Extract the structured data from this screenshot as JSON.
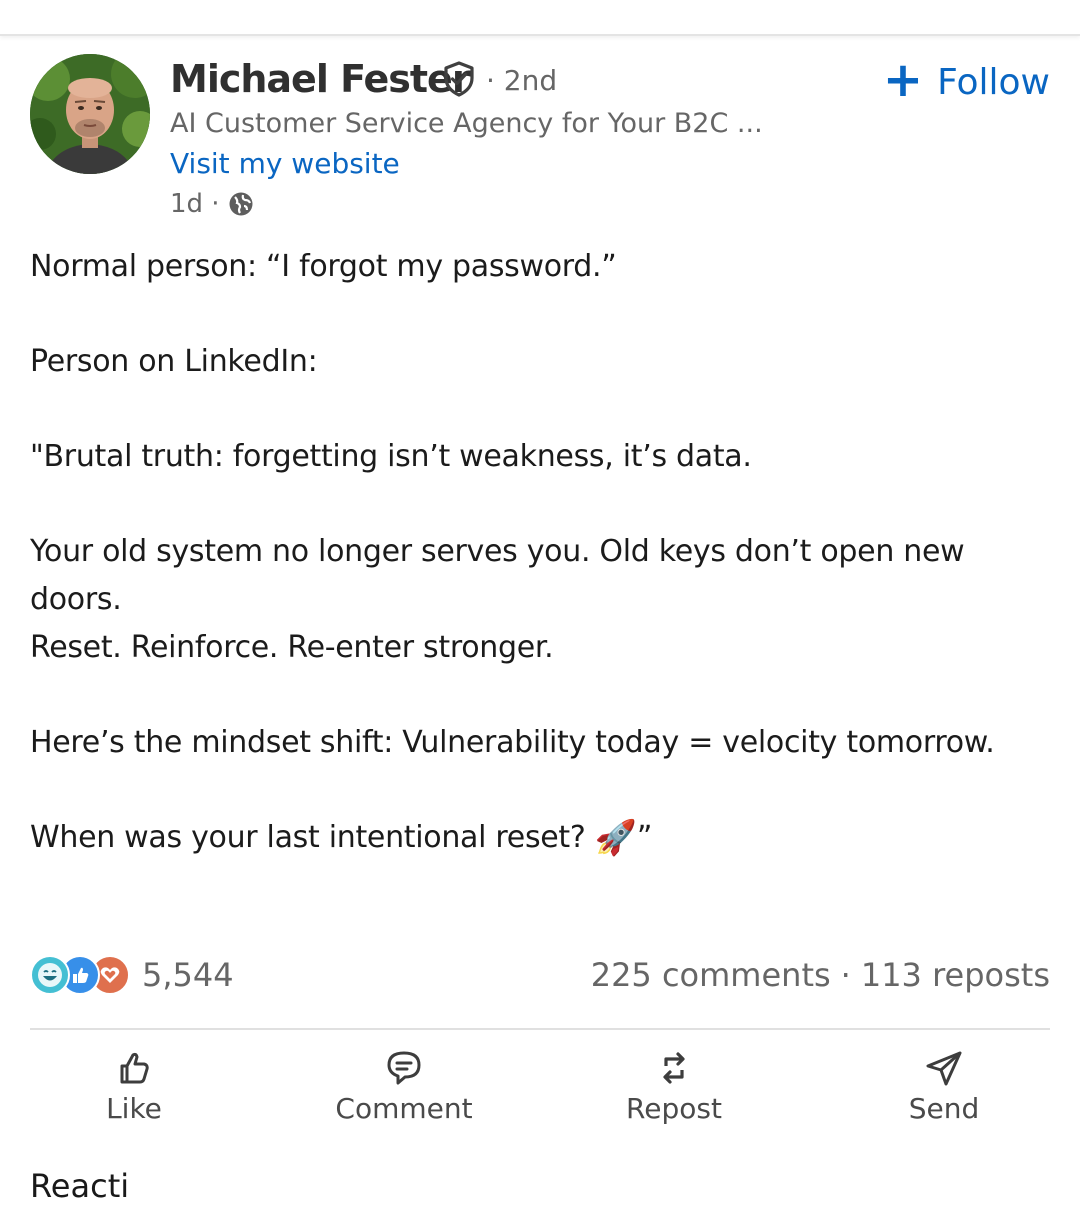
{
  "author": {
    "name": "Michael Fester",
    "degree": "· 2nd",
    "headline": "AI Customer Service Agency for Your B2C ...",
    "website_link": "Visit my website",
    "timestamp": "1d ·"
  },
  "follow": {
    "icon": "+",
    "label": "Follow"
  },
  "post": {
    "lines": [
      "Normal person: “I forgot my password.”",
      "Person on LinkedIn:",
      "\"Brutal truth: forgetting isn’t weakness, it’s data.",
      "Your old system no longer serves you. Old keys don’t open new doors.",
      "Reset. Reinforce. Re-enter stronger.",
      "Here’s the mindset shift: Vulnerability today = velocity tomorrow.",
      "When was your last intentional reset?",
      "🚀",
      "”"
    ]
  },
  "social": {
    "reaction_count": "5,544",
    "comments": "225 comments",
    "separator": "·",
    "reposts": "113 reposts"
  },
  "actions": {
    "like": "Like",
    "comment": "Comment",
    "repost": "Repost",
    "send": "Send"
  },
  "cut_off_text": "Reacti",
  "icons": {
    "verified": "verified-shield-icon",
    "globe": "globe-icon",
    "reactions": [
      "funny-reaction-icon",
      "like-reaction-icon",
      "love-reaction-icon"
    ],
    "like": "thumbs-up-icon",
    "comment": "speech-bubble-icon",
    "repost": "repost-arrows-icon",
    "send": "paper-plane-icon"
  },
  "colors": {
    "link_blue": "#0a66c2",
    "secondary_text": "#666666",
    "love_red": "#df704d",
    "like_blue": "#378fe9",
    "funny_teal": "#44bfd3"
  }
}
